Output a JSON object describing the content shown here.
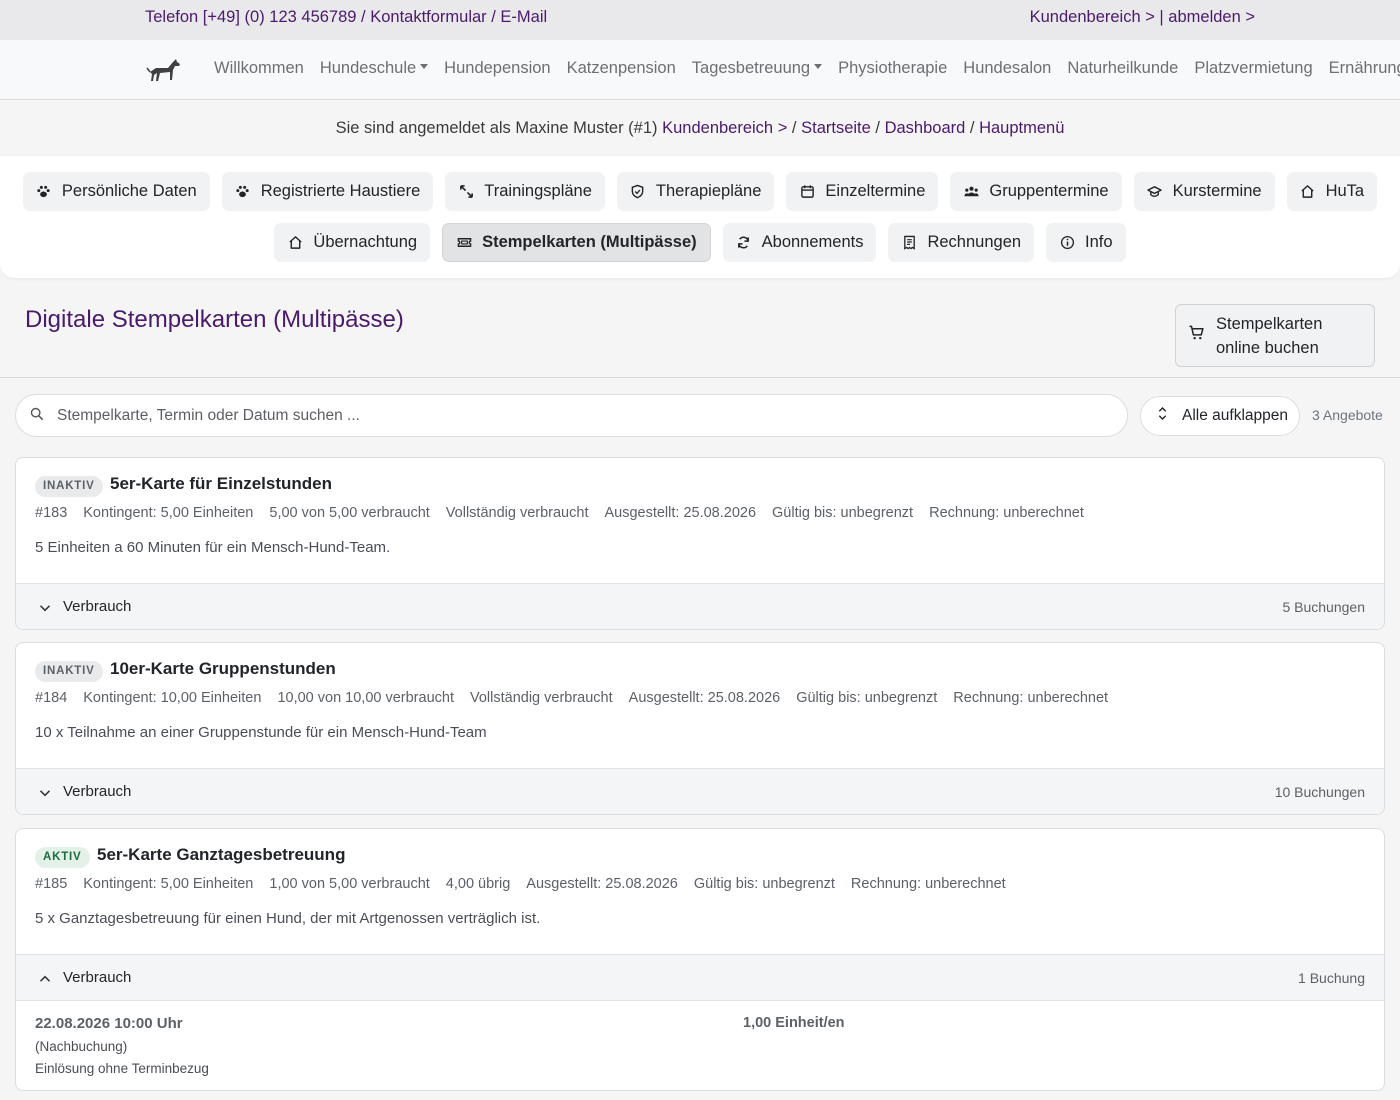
{
  "topbar": {
    "contact_text": "Telefon [+49] (0) 123 456789 / Kontaktformular / E-Mail",
    "account_text": "Kundenbereich > | abmelden >"
  },
  "nav": {
    "items": [
      "Willkommen",
      "Hundeschule",
      "Hundepension",
      "Katzenpension",
      "Tagesbetreuung",
      "Physiotherapie",
      "Hundesalon",
      "Naturheilkunde",
      "Platzvermietung",
      "Ernährungs"
    ],
    "dropdown_items": [
      "Hundeschule",
      "Tagesbetreuung"
    ]
  },
  "status": {
    "prefix": "Sie sind angemeldet als Maxine Muster (#1)",
    "link_customer": "Kundenbereich >",
    "sep1": " / ",
    "link_home": "Startseite",
    "sep2": " / ",
    "link_dashboard": "Dashboard",
    "sep3": " / ",
    "link_menu": "Hauptmenü"
  },
  "tabs": {
    "row1": [
      {
        "label": "Persönliche Daten",
        "icon": "paw-icon"
      },
      {
        "label": "Registrierte Haustiere",
        "icon": "paw-icon"
      },
      {
        "label": "Trainingspläne",
        "icon": "expand-arrows-icon"
      },
      {
        "label": "Therapiepläne",
        "icon": "shield-icon"
      },
      {
        "label": "Einzeltermine",
        "icon": "calendar-icon"
      },
      {
        "label": "Gruppentermine",
        "icon": "group-icon"
      },
      {
        "label": "Kurstermine",
        "icon": "graduation-cap-icon"
      },
      {
        "label": "HuTa",
        "icon": "home-icon"
      }
    ],
    "row2": [
      {
        "label": "Übernachtung",
        "icon": "home-icon"
      },
      {
        "label": "Stempelkarten (Multipässe)",
        "icon": "ticket-icon",
        "active": true
      },
      {
        "label": "Abonnements",
        "icon": "refresh-icon"
      },
      {
        "label": "Rechnungen",
        "icon": "receipt-icon"
      },
      {
        "label": "Info",
        "icon": "info-icon"
      }
    ]
  },
  "page": {
    "title": "Digitale Stempelkarten (Multipässe)",
    "buy_button_line1": "Stempelkarten",
    "buy_button_line2": "online buchen"
  },
  "search": {
    "placeholder": "Stempelkarte, Termin oder Datum suchen ...",
    "value": ""
  },
  "expand_button": "Alle aufklappen",
  "offers_count": "3 Angebote",
  "cards": [
    {
      "status": "INAKTIV",
      "title": "5er-Karte für Einzelstunden",
      "meta": [
        "#183",
        "Kontingent: 5,00 Einheiten",
        "5,00 von 5,00 verbraucht",
        "Vollständig verbraucht",
        "Ausgestellt: 25.08.2026",
        "Gültig bis: unbegrenzt",
        "Rechnung: unberechnet"
      ],
      "description": "5 Einheiten a 60 Minuten für ein Mensch-Hund-Team.",
      "footer_label": "Verbrauch",
      "bookings_count": "5 Buchungen",
      "expanded": false
    },
    {
      "status": "INAKTIV",
      "title": "10er-Karte Gruppenstunden",
      "meta": [
        "#184",
        "Kontingent: 10,00 Einheiten",
        "10,00 von 10,00 verbraucht",
        "Vollständig verbraucht",
        "Ausgestellt: 25.08.2026",
        "Gültig bis: unbegrenzt",
        "Rechnung: unberechnet"
      ],
      "description": "10 x Teilnahme an einer Gruppenstunde für ein Mensch-Hund-Team",
      "footer_label": "Verbrauch",
      "bookings_count": "10 Buchungen",
      "expanded": false
    },
    {
      "status": "AKTIV",
      "title": "5er-Karte Ganztagesbetreuung",
      "meta": [
        "#185",
        "Kontingent: 5,00 Einheiten",
        "1,00 von 5,00 verbraucht",
        "4,00 übrig",
        "Ausgestellt: 25.08.2026",
        "Gültig bis: unbegrenzt",
        "Rechnung: unberechnet"
      ],
      "description": "5 x Ganztagesbetreuung für einen Hund, der mit Artgenossen verträglich ist.",
      "footer_label": "Verbrauch",
      "bookings_count": "1 Buchung",
      "expanded": true,
      "booking": {
        "datetime": "22.08.2026 10:00 Uhr",
        "note1": "(Nachbuchung)",
        "note2": "Einlösung ohne Terminbezug",
        "amount": "1,00 Einheit/en"
      }
    }
  ],
  "colors": {
    "brand_purple": "#4a1a6b",
    "active_green": "#1d6b3e",
    "active_green_bg": "#e3f1e8",
    "inactive_bg": "#e9eaec"
  }
}
